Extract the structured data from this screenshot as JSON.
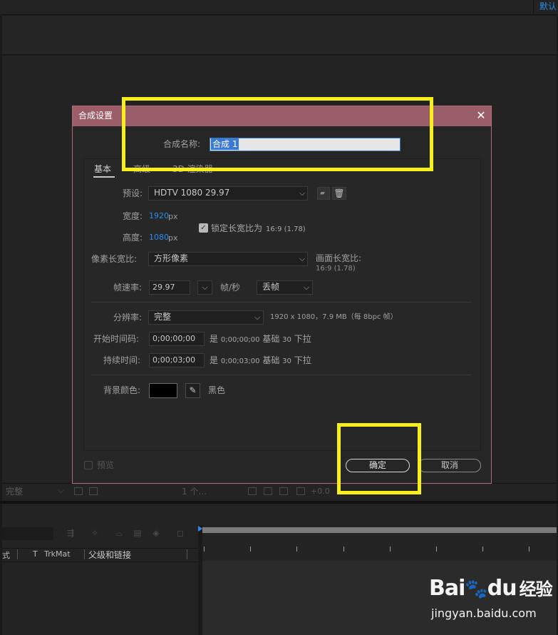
{
  "app": {
    "topbar_right_label": "默认",
    "viewer_toolbar": {
      "zoom": "完整",
      "view_count": "1 个...",
      "exposure": "+0.0"
    },
    "timeline": {
      "col_mode": "式",
      "col_t": "T",
      "col_trkmat": "TrkMat",
      "col_parent": "父级和链接"
    }
  },
  "dialog": {
    "title": "合成设置",
    "close_glyph": "✕",
    "name_label": "合成名称:",
    "name_value": "合成 1",
    "tabs": [
      {
        "label": "基本",
        "active": true
      },
      {
        "label": "高级",
        "active": false
      },
      {
        "label": "3D 渲染器",
        "active": false
      }
    ],
    "preset": {
      "label": "预设:",
      "value": "HDTV 1080 29.97"
    },
    "width": {
      "label": "宽度:",
      "value": "1920",
      "unit": "px"
    },
    "height": {
      "label": "高度:",
      "value": "1080",
      "unit": "px"
    },
    "lock_aspect": {
      "checked": true,
      "label": "锁定长宽比为",
      "ratio": "16:9 (1.78)"
    },
    "pixel_aspect": {
      "label": "像素长宽比:",
      "value": "方形像素"
    },
    "frame_aspect": {
      "label": "画面长宽比:",
      "value": "16:9 (1.78)"
    },
    "frame_rate": {
      "label": "帧速率:",
      "value": "29.97",
      "unit": "帧/秒",
      "mode": "丢帧"
    },
    "resolution": {
      "label": "分辨率:",
      "value": "完整",
      "info": "1920 x 1080，7.9 MB（每 8bpc 帧）"
    },
    "start_timecode": {
      "label": "开始时间码:",
      "value": "0;00;00;00",
      "is": "是",
      "equiv": "0;00;00;00",
      "base": "基础",
      "base_val": "30",
      "pulldown": "下拉"
    },
    "duration": {
      "label": "持续时间:",
      "value": "0;00;03;00",
      "is": "是",
      "equiv": "0;00;03;00",
      "base": "基础",
      "base_val": "30",
      "pulldown": "下拉"
    },
    "background": {
      "label": "背景颜色:",
      "color": "#000000",
      "name": "黑色"
    },
    "preview": {
      "label": "预览",
      "checked": false
    },
    "ok_label": "确定",
    "cancel_label": "取消"
  },
  "highlight_color": "#f7ee1a",
  "watermark": {
    "logo_text_a": "Bai",
    "logo_text_b": "du",
    "logo_cn": "经验",
    "url": "jingyan.baidu.com"
  }
}
